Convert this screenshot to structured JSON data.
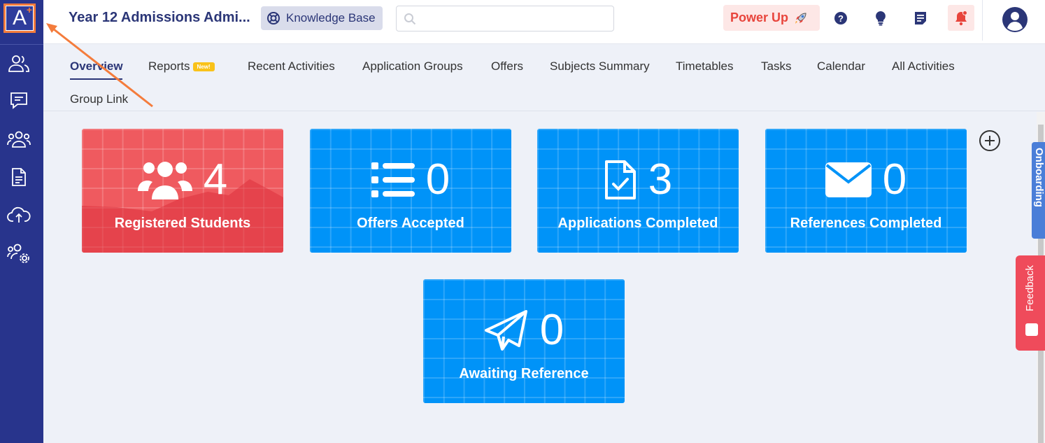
{
  "app": {
    "title": "Year 12 Admissions Admi...",
    "logo_letter": "A",
    "logo_plus": "+"
  },
  "topbar": {
    "knowledge_base_label": "Knowledge Base",
    "search_placeholder": "",
    "power_up_label": "Power Up"
  },
  "sidebar": {
    "items": [
      {
        "icon": "users-icon"
      },
      {
        "icon": "chat-icon"
      },
      {
        "icon": "group-icon"
      },
      {
        "icon": "document-icon"
      },
      {
        "icon": "cloud-upload-icon"
      },
      {
        "icon": "user-settings-icon"
      }
    ]
  },
  "tabs": [
    {
      "label": "Overview",
      "active": true
    },
    {
      "label": "Reports",
      "badge": "New!"
    },
    {
      "label": "Recent Activities"
    },
    {
      "label": "Application Groups"
    },
    {
      "label": "Offers"
    },
    {
      "label": "Subjects Summary"
    },
    {
      "label": "Timetables"
    },
    {
      "label": "Tasks"
    },
    {
      "label": "Calendar"
    },
    {
      "label": "All Activities"
    },
    {
      "label": "Group Link"
    }
  ],
  "cards": [
    {
      "label": "Registered Students",
      "count": "4",
      "icon": "users-icon",
      "color": "#ef5a5f"
    },
    {
      "label": "Offers Accepted",
      "count": "0",
      "icon": "list-icon",
      "color": "#0093f8"
    },
    {
      "label": "Applications Completed",
      "count": "3",
      "icon": "document-check-icon",
      "color": "#0093f8"
    },
    {
      "label": "References Completed",
      "count": "0",
      "icon": "envelope-icon",
      "color": "#0093f8"
    },
    {
      "label": "Awaiting Reference",
      "count": "0",
      "icon": "paper-plane-icon",
      "color": "#0093f8"
    }
  ],
  "side_tabs": {
    "onboarding": "Onboarding",
    "feedback": "Feedback"
  },
  "colors": {
    "sidebar": "#28348c",
    "accent": "#2b3677",
    "annotation": "#f47c3c"
  }
}
